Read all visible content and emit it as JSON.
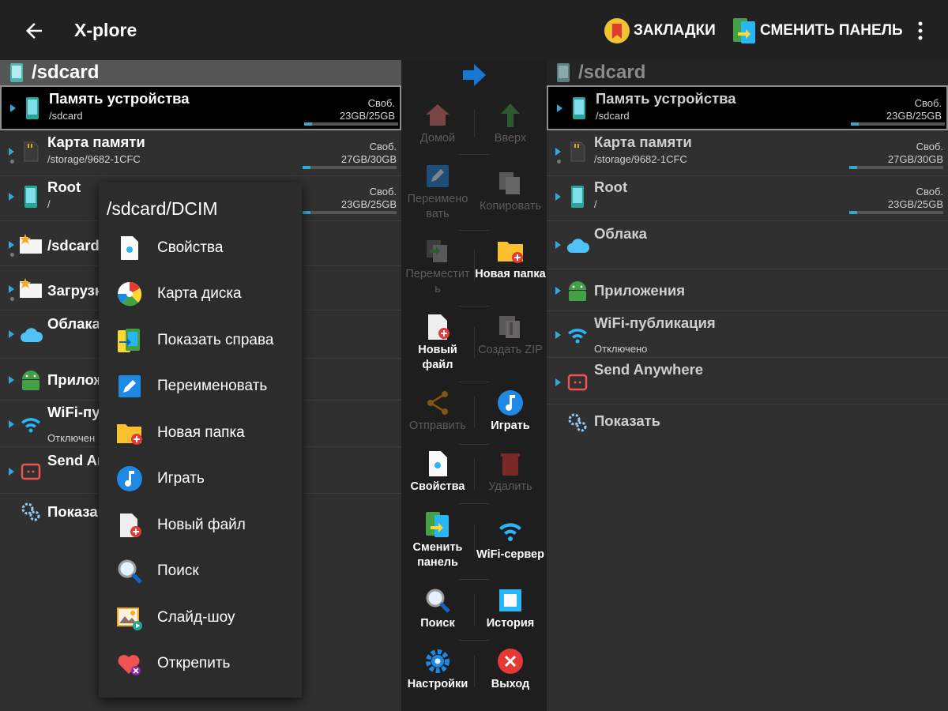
{
  "header": {
    "title": "X-plore",
    "bookmarks_label": "ЗАКЛАДКИ",
    "switch_panel_label": "СМЕНИТЬ ПАНЕЛЬ"
  },
  "left_pane": {
    "path": "/sdcard",
    "items": [
      {
        "label": "Память устройства",
        "sub": "/sdcard",
        "free_label": "Своб.",
        "free": "23GB/25GB",
        "usage": 0.08
      },
      {
        "label": "Карта памяти",
        "sub": "/storage/9682-1CFC",
        "free_label": "Своб.",
        "free": "27GB/30GB",
        "usage": 0.08
      },
      {
        "label": "Root",
        "sub": "/",
        "free_label": "Своб.",
        "free": "23GB/25GB",
        "usage": 0.08
      },
      {
        "label": "/sdcard"
      },
      {
        "label": "Загрузк"
      },
      {
        "label": "Облака"
      },
      {
        "label": "Прилож"
      },
      {
        "label": "WiFi-пу",
        "sub": "Отключен"
      },
      {
        "label": "Send An"
      },
      {
        "label": "Показа"
      }
    ]
  },
  "right_pane": {
    "path": "/sdcard",
    "items": [
      {
        "label": "Память устройства",
        "sub": "/sdcard",
        "free_label": "Своб.",
        "free": "23GB/25GB",
        "usage": 0.08
      },
      {
        "label": "Карта памяти",
        "sub": "/storage/9682-1CFC",
        "free_label": "Своб.",
        "free": "27GB/30GB",
        "usage": 0.08
      },
      {
        "label": "Root",
        "sub": "/",
        "free_label": "Своб.",
        "free": "23GB/25GB",
        "usage": 0.08
      },
      {
        "label": "Облака"
      },
      {
        "label": "Приложения"
      },
      {
        "label": "WiFi-публикация",
        "sub": "Отключено"
      },
      {
        "label": "Send Anywhere"
      },
      {
        "label": "Показать"
      }
    ]
  },
  "toolbar": {
    "home": "Домой",
    "up": "Вверх",
    "rename": "Переимено вать",
    "copy": "Копировать",
    "move": "Переместит ь",
    "new_folder": "Новая папка",
    "new_file": "Новый файл",
    "create_zip": "Создать ZIP",
    "send": "Отправить",
    "play": "Играть",
    "properties": "Свойства",
    "delete": "Удалить",
    "switch_panel": "Сменить панель",
    "wifi_server": "WiFi-сервер",
    "search": "Поиск",
    "history": "История",
    "settings": "Настройки",
    "exit": "Выход"
  },
  "context_menu": {
    "title": "/sdcard/DCIM",
    "items": [
      {
        "label": "Свойства",
        "icon": "properties-icon"
      },
      {
        "label": "Карта диска",
        "icon": "disk-map-icon"
      },
      {
        "label": "Показать справа",
        "icon": "show-right-icon"
      },
      {
        "label": "Переименовать",
        "icon": "rename-icon"
      },
      {
        "label": "Новая папка",
        "icon": "new-folder-icon"
      },
      {
        "label": "Играть",
        "icon": "play-icon"
      },
      {
        "label": "Новый файл",
        "icon": "new-file-icon"
      },
      {
        "label": "Поиск",
        "icon": "search-icon"
      },
      {
        "label": "Слайд-шоу",
        "icon": "slideshow-icon"
      },
      {
        "label": "Открепить",
        "icon": "unpin-icon"
      }
    ]
  },
  "colors": {
    "accent": "#35a7d6",
    "topbar": "#212121",
    "pane": "#303030",
    "toolbar": "#1e1e1e"
  }
}
